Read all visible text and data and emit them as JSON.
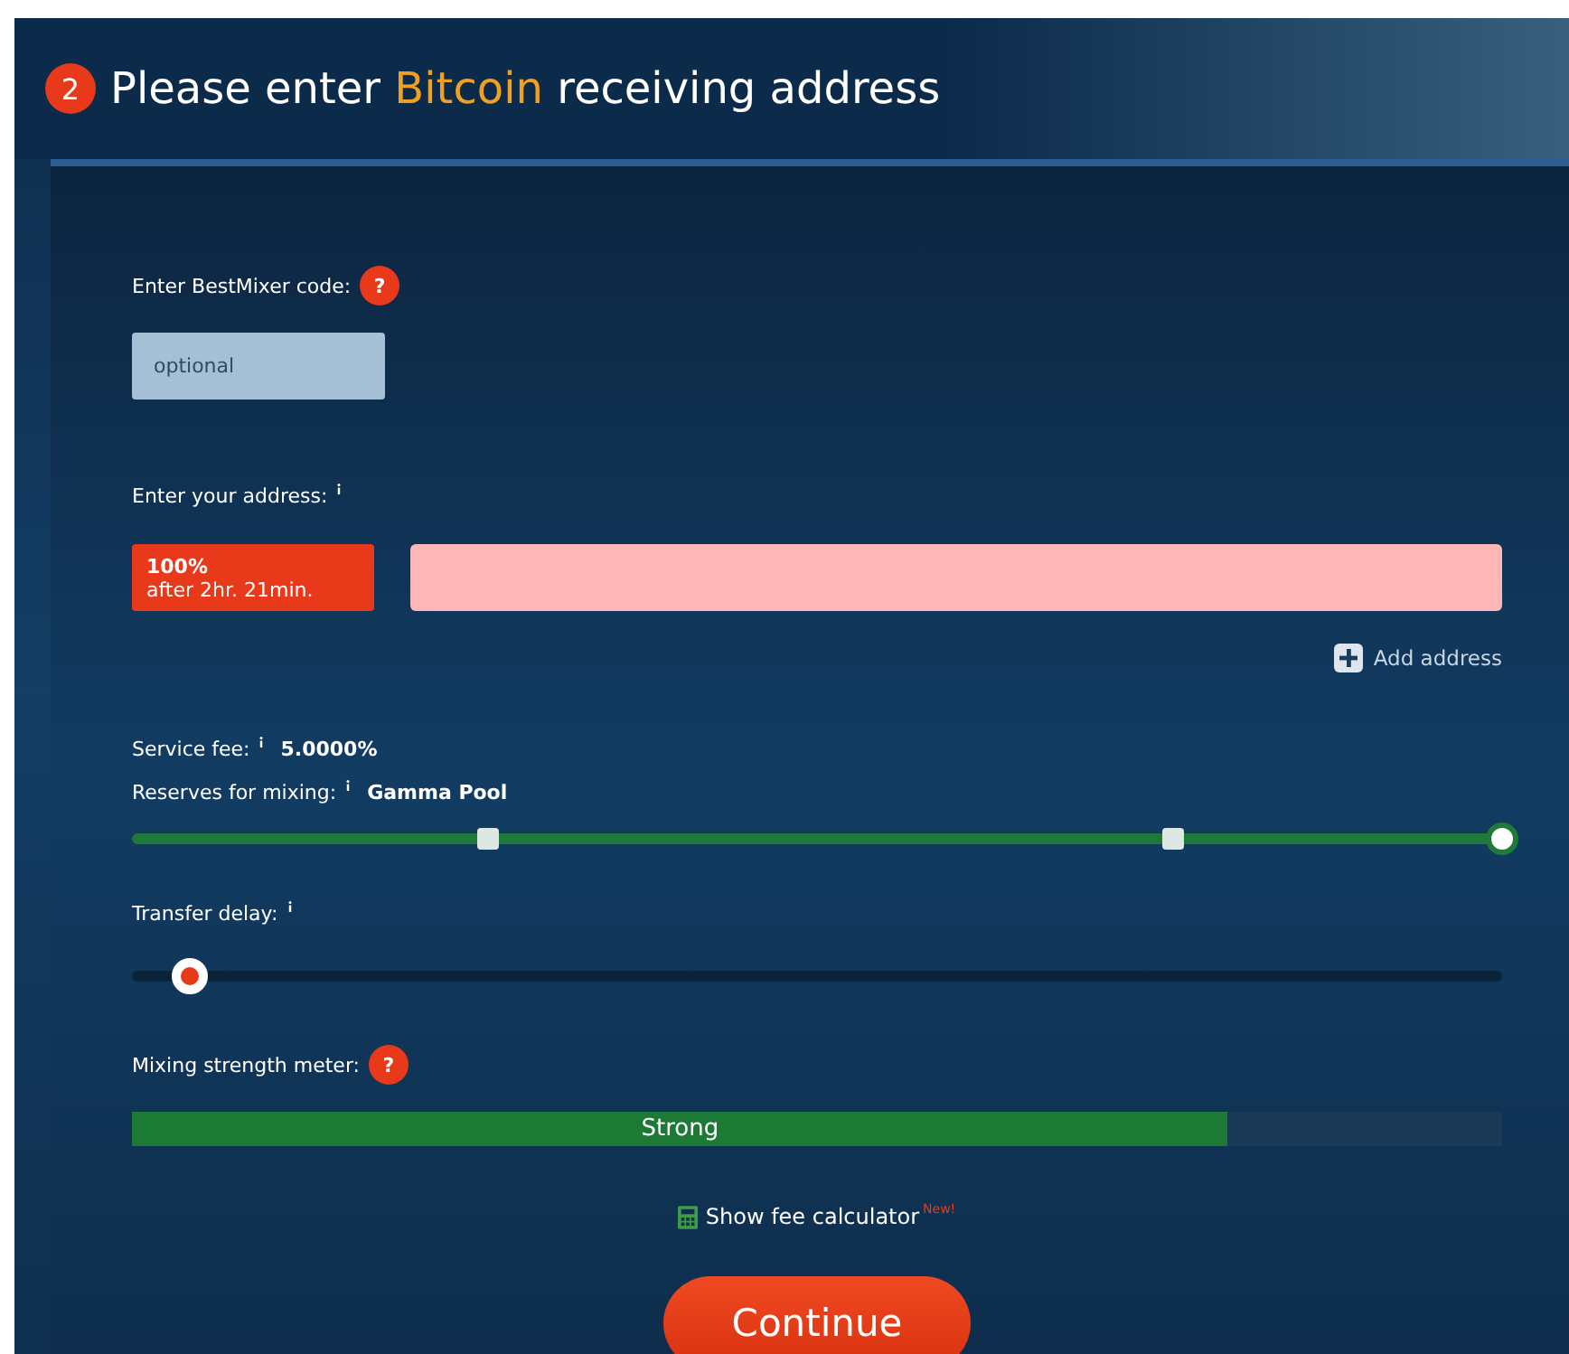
{
  "header": {
    "step": "2",
    "title_before": "Please enter",
    "title_highlight": "Bitcoin",
    "title_after": "receiving address"
  },
  "code": {
    "label": "Enter BestMixer code:",
    "help": "?",
    "placeholder": "optional"
  },
  "address": {
    "label": "Enter your address:",
    "share": "100%",
    "delay": "after 2hr. 21min.",
    "add_label": "Add address"
  },
  "fee": {
    "label": "Service fee:",
    "value": "5.0000%"
  },
  "reserves": {
    "label": "Reserves for mixing:",
    "value": "Gamma Pool",
    "level": 1,
    "handles": [
      {
        "level": 0.26
      },
      {
        "level": 0.76
      }
    ]
  },
  "transfer_delay": {
    "label": "Transfer delay:",
    "level": 0.035
  },
  "strength": {
    "label": "Mixing strength meter:",
    "help": "?",
    "level": 0.8,
    "text": "Strong"
  },
  "calculator": {
    "label": "Show fee calculator",
    "badge": "New!"
  },
  "continue_button": "Continue"
}
